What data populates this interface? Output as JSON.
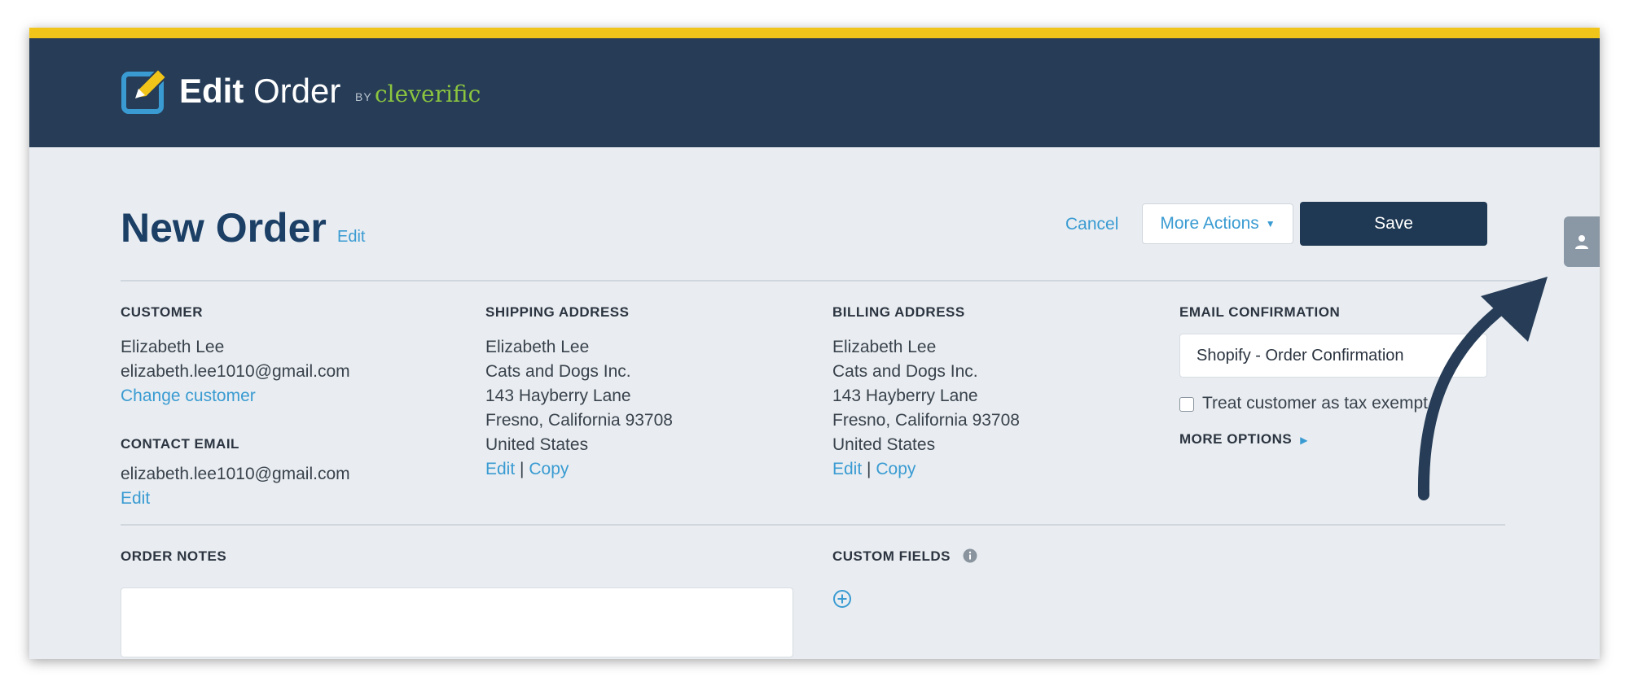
{
  "brand": {
    "name_bold": "Edit",
    "name_light": "Order",
    "by": "BY",
    "company": "cleverific",
    "colors": {
      "accent_bar": "#f0c419",
      "header_bg": "#263c57",
      "brand_green": "#8bc53f",
      "link": "#3a9bd2"
    }
  },
  "page": {
    "title": "New Order",
    "title_edit": "Edit"
  },
  "toolbar": {
    "cancel": "Cancel",
    "more_actions": "More Actions",
    "save": "Save",
    "side_icon": "user-icon"
  },
  "customer": {
    "label": "CUSTOMER",
    "name": "Elizabeth Lee",
    "email": "elizabeth.lee1010@gmail.com",
    "change": "Change customer",
    "contact_label": "CONTACT EMAIL",
    "contact_email": "elizabeth.lee1010@gmail.com",
    "contact_edit": "Edit"
  },
  "shipping": {
    "label": "SHIPPING ADDRESS",
    "lines": [
      "Elizabeth Lee",
      "Cats and Dogs Inc.",
      "143 Hayberry Lane",
      "Fresno, California 93708",
      "United States"
    ],
    "edit": "Edit",
    "sep": "|",
    "copy": "Copy"
  },
  "billing": {
    "label": "BILLING ADDRESS",
    "lines": [
      "Elizabeth Lee",
      "Cats and Dogs Inc.",
      "143 Hayberry Lane",
      "Fresno, California 93708",
      "United States"
    ],
    "edit": "Edit",
    "sep": "|",
    "copy": "Copy"
  },
  "email_confirmation": {
    "label": "EMAIL CONFIRMATION",
    "selected": "Shopify - Order Confirmation",
    "tax_exempt": "Treat customer as tax exempt",
    "tax_exempt_checked": false,
    "more_options": "MORE OPTIONS"
  },
  "order_notes": {
    "label": "ORDER NOTES",
    "value": ""
  },
  "custom_fields": {
    "label": "CUSTOM FIELDS",
    "info_icon": "info-icon",
    "add_icon": "plus-circle-icon"
  }
}
